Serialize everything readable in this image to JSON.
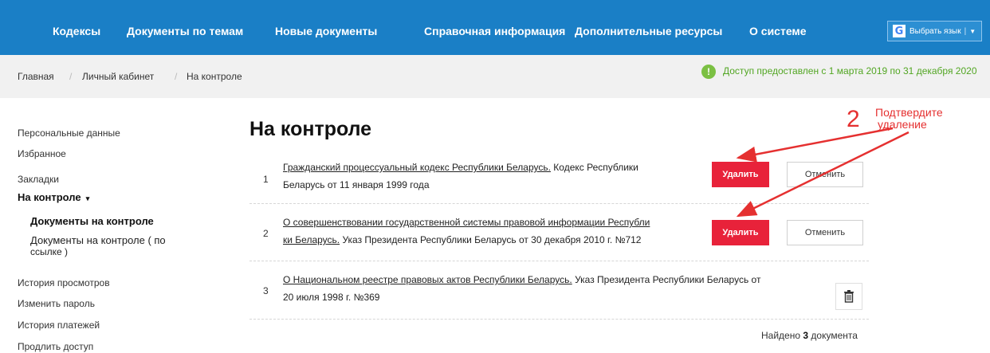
{
  "nav": {
    "items": [
      "Кодексы",
      "Документы по темам",
      "Новые документы",
      "Справочная информация",
      "Дополнительные ресурсы",
      "О системе"
    ],
    "lang_label": "Выбрать язык",
    "lang_icon": "google-icon",
    "background": "#1a7fc6"
  },
  "breadcrumb": {
    "items": [
      "Главная",
      "Личный кабинет",
      "На контроле"
    ],
    "separator": "/"
  },
  "access": {
    "icon": "info-icon",
    "text": "Доступ предоставлен с 1 марта 2019 по 31 декабря 2020",
    "color": "#52a623"
  },
  "sidebar": {
    "items": [
      "Персональные данные",
      "Избранное",
      "Закладки",
      "На контроле",
      "Документы на контроле",
      "Документы на контроле ( по",
      "ссылке )",
      "История просмотров",
      "Изменить пароль",
      "История платежей",
      "Продлить доступ"
    ]
  },
  "main": {
    "title": "На контроле",
    "documents": [
      {
        "num": "1",
        "link": [
          "Гражданский процессуальный кодекс Республики Беларусь."
        ],
        "desc": [
          "Кодекс Республики",
          "Беларусь от 11 января 1999 года"
        ]
      },
      {
        "num": "2",
        "link": [
          "О совершенствовании государственной системы правовой информации Республи",
          "ки Беларусь."
        ],
        "desc": [
          "Указ Президента Республики Беларусь от 30 декабря 2010 г. №712"
        ]
      },
      {
        "num": "3",
        "link": [
          "О Национальном реестре правовых актов Республики Беларусь."
        ],
        "desc": [
          "Указ Президента Республики Беларусь от",
          "20 июля 1998 г. №369"
        ]
      }
    ],
    "delete_label": "Удалить",
    "cancel_label": "Отменить",
    "found_prefix": "Найдено",
    "found_count": "3",
    "found_suffix": "документа"
  },
  "annotation": {
    "number": "2",
    "lines": [
      "Подтвердите",
      "удаление"
    ],
    "color": "#e53030"
  },
  "colors": {
    "delete": "#e8223a",
    "breadcrumb_bg": "#f1f1f1"
  }
}
